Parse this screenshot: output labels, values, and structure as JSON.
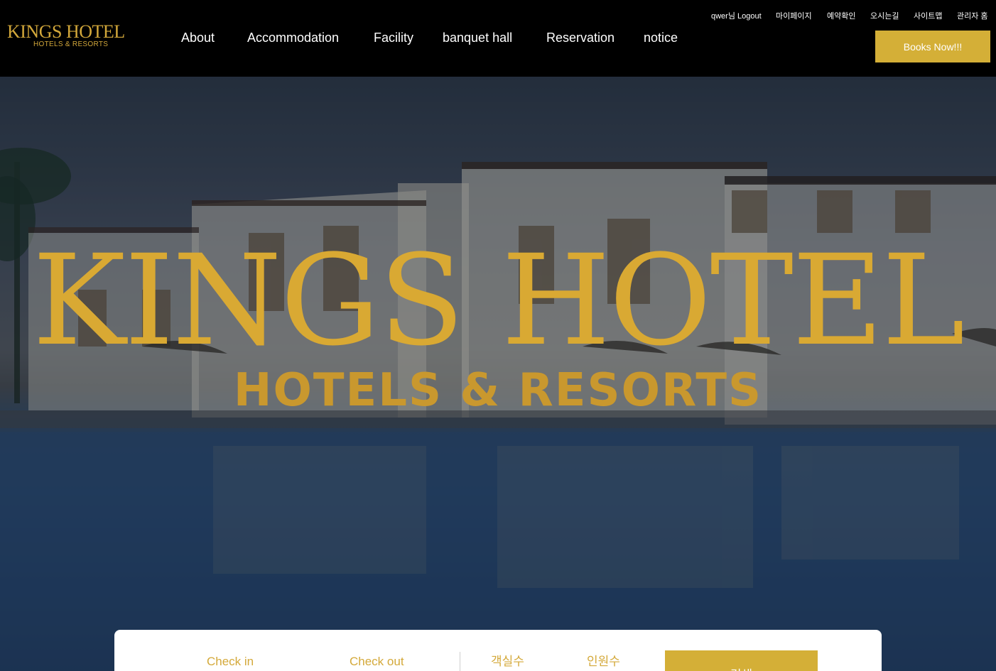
{
  "logo": {
    "main": "KINGS HOTEL",
    "sub": "HOTELS & RESORTS"
  },
  "nav": [
    "About",
    "Accommodation",
    "Facility",
    "banquet hall",
    "Reservation",
    "notice"
  ],
  "util": [
    "qwer님 Logout",
    "마이페이지",
    "예약확인",
    "오시는길",
    "사이트맵",
    "관리자 홈"
  ],
  "book_button": "Books Now!!!",
  "hero": {
    "title": "KINGS HOTEL",
    "subtitle": "HOTELS & RESORTS"
  },
  "booking": {
    "checkin": "Check in",
    "checkout": "Check out",
    "rooms": "객실수",
    "guests": "인원수",
    "search": "검색"
  },
  "colors": {
    "gold": "#d4af37",
    "header_bg": "#000000",
    "text_light": "#ffffff"
  }
}
